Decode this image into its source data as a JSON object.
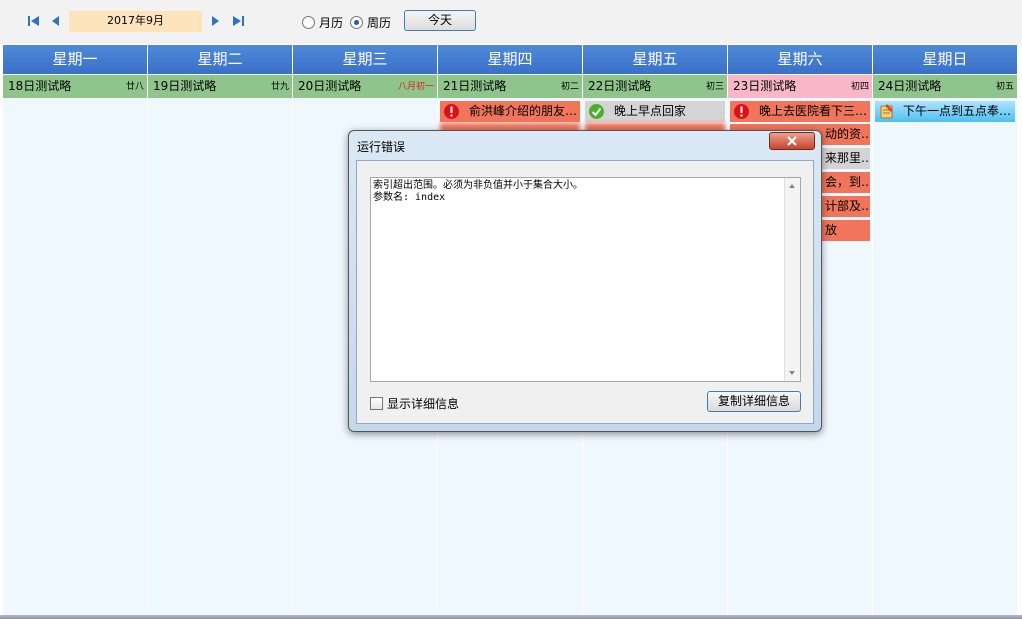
{
  "toolbar": {
    "current_month": "2017年9月",
    "view_month_label": "月历",
    "view_week_label": "周历",
    "selected_view": "week",
    "today_label": "今天",
    "icons": [
      "first-icon",
      "prev-icon",
      "next-icon",
      "last-icon"
    ]
  },
  "weekdays": [
    "星期一",
    "星期二",
    "星期三",
    "星期四",
    "星期五",
    "星期六",
    "星期日"
  ],
  "dates": [
    {
      "label": "18日测试略",
      "lunar": "廿八"
    },
    {
      "label": "19日测试略",
      "lunar": "廿九"
    },
    {
      "label": "20日测试略",
      "lunar": "八月初一"
    },
    {
      "label": "21日测试略",
      "lunar": "初二"
    },
    {
      "label": "22日测试略",
      "lunar": "初三"
    },
    {
      "label": "23日测试略",
      "lunar": "初四"
    },
    {
      "label": "24日测试略",
      "lunar": "初五"
    }
  ],
  "events": {
    "thu": [
      {
        "text": "俞洪峰介绍的朋友…",
        "icon": "error-icon"
      }
    ],
    "fri": [
      {
        "text": "晚上早点回家",
        "icon": "check-icon"
      }
    ],
    "sat": [
      {
        "text": "晚上去医院看下三…",
        "icon": "error-icon"
      },
      {
        "text": "动的资…"
      },
      {
        "text": "来那里…"
      },
      {
        "text": "会，到…"
      },
      {
        "text": "计部及…"
      },
      {
        "text": "放"
      }
    ],
    "sun": [
      {
        "text": "下午一点到五点奉…",
        "icon": "note-icon"
      }
    ]
  },
  "colors": {
    "header_blue": "#3a70c8",
    "date_green": "#8fc58c",
    "date_pink": "#f7b6c9",
    "event_red": "#f0755a",
    "event_gray": "#d4d4d4",
    "event_blue": "#4ec0f0"
  },
  "dialog": {
    "title": "运行错误",
    "message_line1": "索引超出范围。必须为非负值并小于集合大小。",
    "message_line2": "参数名: index",
    "show_details_label": "显示详细信息",
    "copy_details_label": "复制详细信息"
  }
}
